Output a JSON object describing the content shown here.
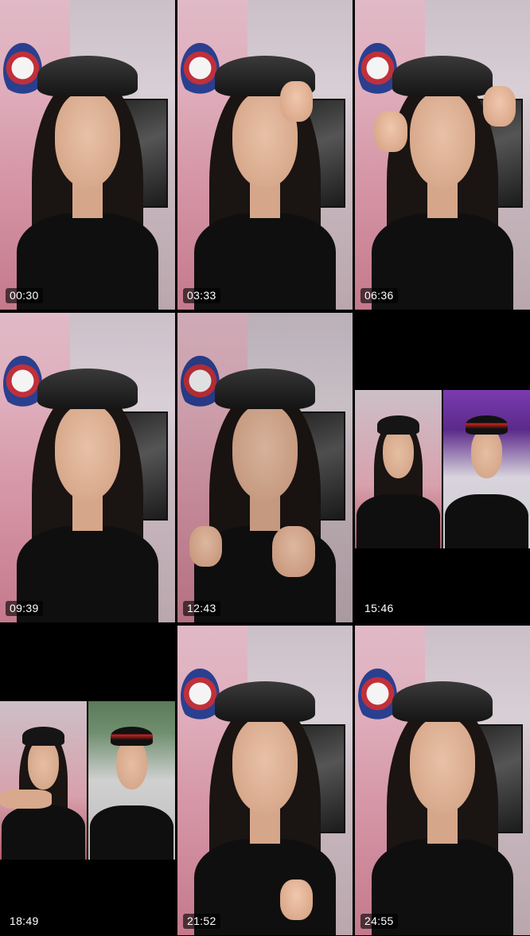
{
  "thumbnails": [
    {
      "timestamp": "00:30"
    },
    {
      "timestamp": "03:33"
    },
    {
      "timestamp": "06:36"
    },
    {
      "timestamp": "09:39"
    },
    {
      "timestamp": "12:43"
    },
    {
      "timestamp": "15:46"
    },
    {
      "timestamp": "18:49"
    },
    {
      "timestamp": "21:52"
    },
    {
      "timestamp": "24:55"
    }
  ]
}
